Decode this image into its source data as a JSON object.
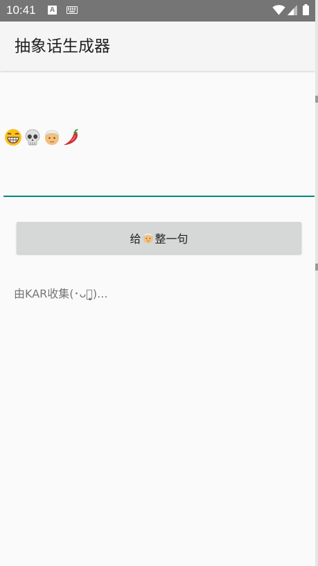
{
  "status_bar": {
    "time": "10:41",
    "notif_letter": "A",
    "keyboard_icon": "keyboard-icon",
    "wifi_icon": "wifi-icon",
    "signal_icon": "signal-icon",
    "battery_icon": "battery-icon"
  },
  "app_bar": {
    "title": "抽象话生成器"
  },
  "output": {
    "emojis": [
      "grinning-face-icon",
      "skull-icon",
      "old-man-icon",
      "hot-pepper-icon"
    ]
  },
  "button": {
    "label_before": "给",
    "emoji": "old-man-icon",
    "label_after": "整一句"
  },
  "credit": {
    "text": "由KAR收集(･ᴗ･̥̩̥̩)..."
  },
  "colors": {
    "status_bar": "#757575",
    "app_bar": "#f5f5f5",
    "accent_underline": "#00897b",
    "button_bg": "#d6d7d7",
    "credit_text": "#757575"
  }
}
